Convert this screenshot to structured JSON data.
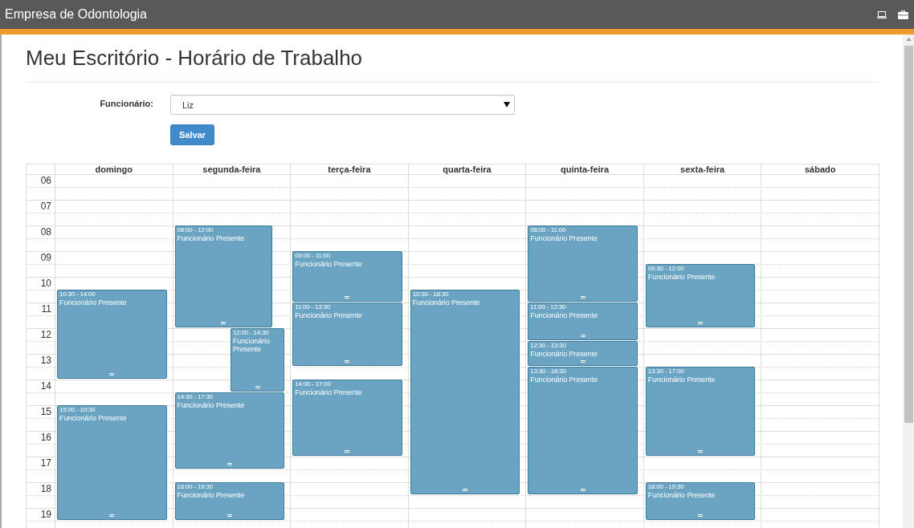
{
  "app_bar": {
    "title": "Empresa de Odontologia"
  },
  "page": {
    "title": "Meu Escritório - Horário de Trabalho"
  },
  "form": {
    "employee_label": "Funcionário:",
    "employee_value": "Liz",
    "save_button": "Salvar"
  },
  "calendar": {
    "hours": [
      "06",
      "07",
      "08",
      "09",
      "10",
      "11",
      "12",
      "13",
      "14",
      "15",
      "16",
      "17",
      "18",
      "19"
    ],
    "days": [
      {
        "name": "domingo",
        "events": [
          {
            "time": "10:30 - 14:00",
            "title": "Funcionário Presente",
            "kind": "full"
          },
          {
            "time": "15:00 - 19:30",
            "title": "Funcionário Presente",
            "kind": "full"
          }
        ]
      },
      {
        "name": "segunda-feira",
        "events": [
          {
            "time": "08:00 - 12:00",
            "title": "Funcionário Presente",
            "kind": "left"
          },
          {
            "time": "12:00 - 14:30",
            "title": "Funcionário Presente",
            "kind": "right"
          },
          {
            "time": "14:30 - 17:30",
            "title": "Funcionário Presente",
            "kind": "full"
          },
          {
            "time": "18:00 - 19:30",
            "title": "Funcionário Presente",
            "kind": "full"
          }
        ]
      },
      {
        "name": "terça-feira",
        "events": [
          {
            "time": "09:00 - 11:00",
            "title": "Funcionário Presente",
            "kind": "full"
          },
          {
            "time": "11:00 - 13:30",
            "title": "Funcionário Presente",
            "kind": "full"
          },
          {
            "time": "14:00 - 17:00",
            "title": "Funcionário Presente",
            "kind": "full"
          }
        ]
      },
      {
        "name": "quarta-feira",
        "events": [
          {
            "time": "10:30 - 18:30",
            "title": "Funcionário Presente",
            "kind": "full"
          }
        ]
      },
      {
        "name": "quinta-feira",
        "events": [
          {
            "time": "08:00 - 11:00",
            "title": "Funcionário Presente",
            "kind": "full"
          },
          {
            "time": "11:00 - 12:30",
            "title": "Funcionário Presente",
            "kind": "full"
          },
          {
            "time": "12:30 - 13:30",
            "title": "Funcionário Presente",
            "kind": "full"
          },
          {
            "time": "13:30 - 18:30",
            "title": "Funcionário Presente",
            "kind": "full"
          }
        ]
      },
      {
        "name": "sexta-feira",
        "events": [
          {
            "time": "09:30 - 12:00",
            "title": "Funcionário Presente",
            "kind": "full"
          },
          {
            "time": "13:30 - 17:00",
            "title": "Funcionário Presente",
            "kind": "full"
          },
          {
            "time": "18:00 - 19:30",
            "title": "Funcionário Presente",
            "kind": "full"
          }
        ]
      },
      {
        "name": "sábado"
      }
    ]
  }
}
